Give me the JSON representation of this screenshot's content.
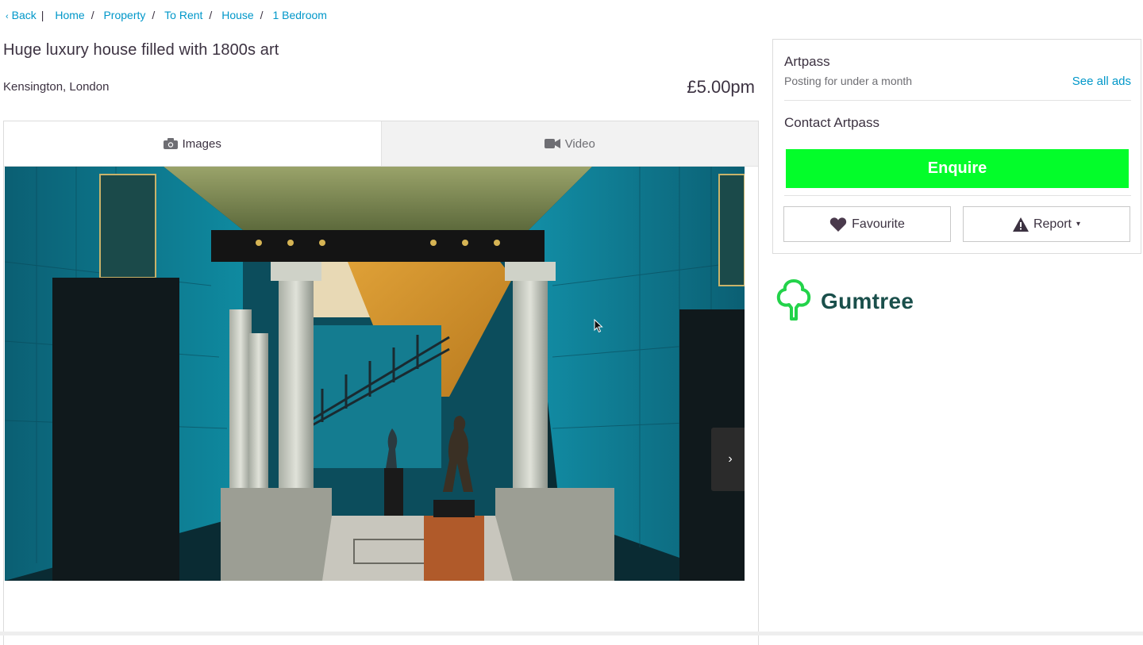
{
  "breadcrumb": {
    "back_label": "Back",
    "items": [
      "Home",
      "Property",
      "To Rent",
      "House",
      "1 Bedroom"
    ]
  },
  "listing": {
    "title": "Huge luxury house filled with 1800s art",
    "location": "Kensington, London",
    "price": "£5.00pm"
  },
  "gallery": {
    "tabs": [
      {
        "label": "Images",
        "icon": "camera-icon",
        "active": true
      },
      {
        "label": "Video",
        "icon": "video-camera-icon",
        "active": false
      }
    ],
    "next_icon": "chevron-right-icon"
  },
  "seller": {
    "name": "Artpass",
    "subtitle": "Posting for under a month",
    "see_all_label": "See all ads",
    "contact_heading": "Contact Artpass",
    "enquire_label": "Enquire",
    "favourite_label": "Favourite",
    "report_label": "Report"
  },
  "brand": {
    "name": "Gumtree",
    "logo_icon": "tree-icon"
  },
  "colors": {
    "link": "#0097c9",
    "enquire": "#03fd2a",
    "brand_green": "#1a4f4b",
    "logo_green": "#23d34a",
    "text": "#3c3241"
  }
}
